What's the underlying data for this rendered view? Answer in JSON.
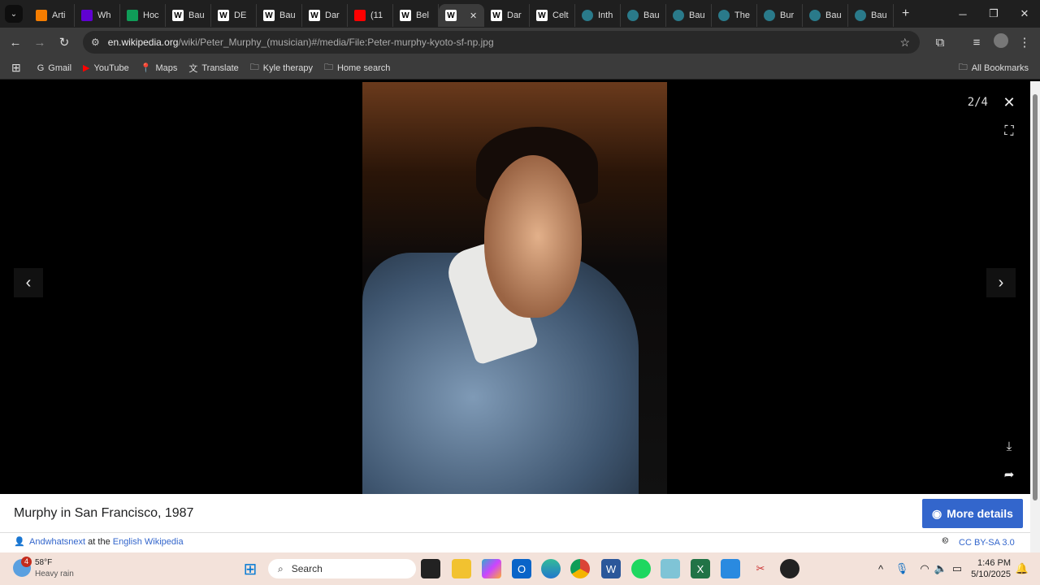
{
  "browser": {
    "tabs": [
      {
        "title": "Arti",
        "icon": "blogger-icon",
        "color": "#f57d00"
      },
      {
        "title": "Wh",
        "icon": "yahoo-icon",
        "color": "#6001d2"
      },
      {
        "title": "Hoc",
        "icon": "sheets-icon",
        "color": "#0f9d58"
      },
      {
        "title": "Bau",
        "icon": "wikipedia-icon",
        "color": "#ffffff"
      },
      {
        "title": "DE",
        "icon": "wikipedia-icon",
        "color": "#ffffff"
      },
      {
        "title": "Bau",
        "icon": "wikipedia-icon",
        "color": "#ffffff"
      },
      {
        "title": "Dar",
        "icon": "wikipedia-icon",
        "color": "#ffffff"
      },
      {
        "title": "(11",
        "icon": "youtube-icon",
        "color": "#ff0000"
      },
      {
        "title": "Bel",
        "icon": "wikipedia-icon",
        "color": "#ffffff"
      },
      {
        "title": "",
        "icon": "wikipedia-icon",
        "color": "#ffffff",
        "active": true
      },
      {
        "title": "Dar",
        "icon": "wikipedia-icon",
        "color": "#ffffff"
      },
      {
        "title": "Celt",
        "icon": "wikipedia-icon",
        "color": "#ffffff"
      },
      {
        "title": "Inth",
        "icon": "wikimedia-icon",
        "color": "#339966"
      },
      {
        "title": "Bau",
        "icon": "wikimedia-icon",
        "color": "#339966"
      },
      {
        "title": "Bau",
        "icon": "wikimedia-icon",
        "color": "#339966"
      },
      {
        "title": "The",
        "icon": "wikimedia-icon",
        "color": "#339966"
      },
      {
        "title": "Bur",
        "icon": "wikimedia-icon",
        "color": "#339966"
      },
      {
        "title": "Bau",
        "icon": "wikimedia-icon",
        "color": "#339966"
      },
      {
        "title": "Bau",
        "icon": "wikimedia-icon",
        "color": "#339966"
      }
    ],
    "url_domain": "en.wikipedia.org",
    "url_path": "/wiki/Peter_Murphy_(musician)#/media/File:Peter-murphy-kyoto-sf-np.jpg",
    "bookmarks": [
      {
        "label": "Gmail",
        "icon": "google-icon"
      },
      {
        "label": "YouTube",
        "icon": "youtube-icon"
      },
      {
        "label": "Maps",
        "icon": "maps-icon"
      },
      {
        "label": "Translate",
        "icon": "translate-icon"
      },
      {
        "label": "Kyle therapy",
        "icon": "folder-icon"
      },
      {
        "label": "Home search",
        "icon": "folder-icon"
      }
    ],
    "all_bookmarks": "All Bookmarks"
  },
  "viewer": {
    "counter": "2/4",
    "caption": "Murphy in San Francisco, 1987",
    "more_details": "More details",
    "author": "Andwhatsnext",
    "at_the": "at the",
    "source": "English Wikipedia",
    "license": "CC BY-SA 3.0",
    "accent": "#3366cc"
  },
  "taskbar": {
    "temp": "58°F",
    "weather": "Heavy rain",
    "weather_badge": "4",
    "search": "Search",
    "time": "1:46 PM",
    "date": "5/10/2025"
  }
}
